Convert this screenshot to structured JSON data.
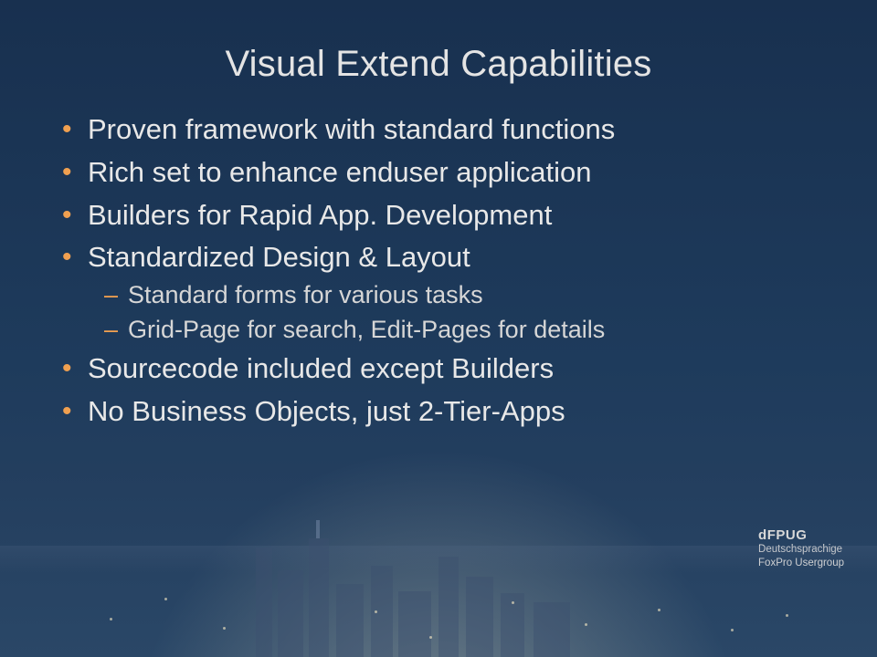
{
  "title": "Visual Extend Capabilities",
  "bullets": [
    {
      "text": "Proven framework with standard functions",
      "sub": []
    },
    {
      "text": "Rich set to enhance enduser application",
      "sub": []
    },
    {
      "text": "Builders for Rapid App. Development",
      "sub": []
    },
    {
      "text": "Standardized Design & Layout",
      "sub": [
        "Standard forms for various tasks",
        "Grid-Page for search, Edit-Pages for details"
      ]
    },
    {
      "text": "Sourcecode included except Builders",
      "sub": []
    },
    {
      "text": "No Business Objects, just 2-Tier-Apps",
      "sub": []
    }
  ],
  "footer": {
    "brand": "dFPUG",
    "line1": "Deutschsprachige",
    "line2": "FoxPro Usergroup"
  }
}
